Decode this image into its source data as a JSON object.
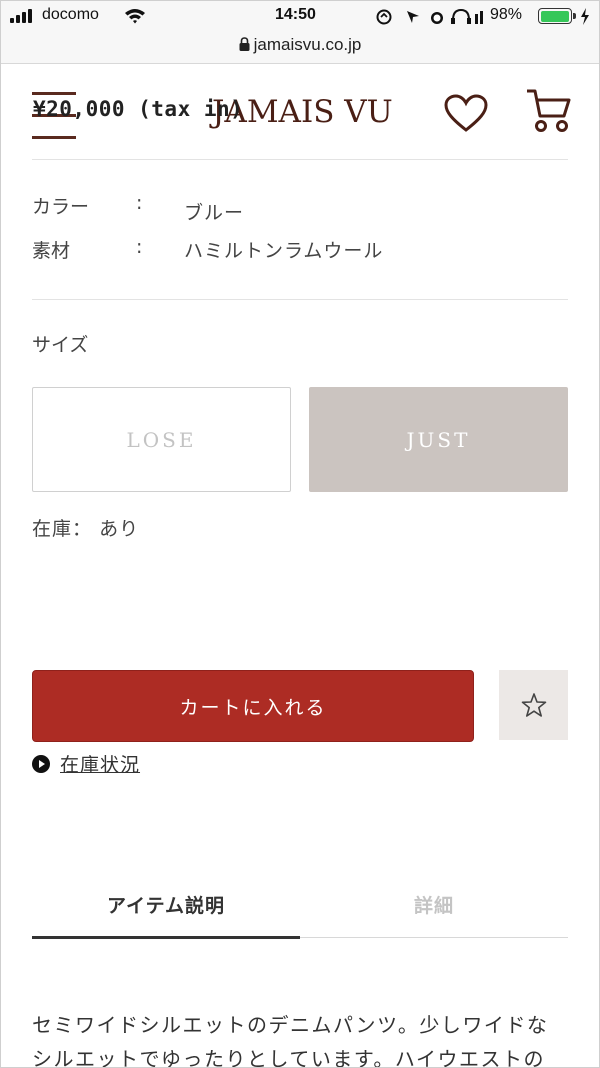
{
  "status_bar": {
    "carrier": "docomo",
    "time": "14:50",
    "battery_percent": "98%",
    "battery_level": 0.98,
    "accent_green": "#35c759"
  },
  "browser": {
    "url": "jamaisvu.co.jp",
    "lock_icon": "lock-icon"
  },
  "header": {
    "logo": "JAMAIS VU",
    "price_overlay": "¥20,000 (tax in)",
    "icons": [
      "menu-icon",
      "heart-icon",
      "cart-icon"
    ],
    "brand_color": "#4a1f15"
  },
  "specs": [
    {
      "key": "カラー",
      "sep": ":",
      "value": "ブルー"
    },
    {
      "key": "素材",
      "sep": ":",
      "value": "ハミルトンラムウール"
    }
  ],
  "size": {
    "label": "サイズ",
    "options": [
      {
        "label": "LOSE",
        "selected": false
      },
      {
        "label": "JUST",
        "selected": true
      }
    ]
  },
  "stock": {
    "label": "在庫：",
    "value": "あり"
  },
  "actions": {
    "cart_label": "カートに入れる",
    "cart_color": "#ad2c24",
    "favorite_icon": "star-icon",
    "stock_link_label": "在庫状況"
  },
  "tabs": {
    "items": [
      "アイテム説明",
      "詳細"
    ],
    "active_index": 0
  },
  "description": {
    "line1": "セミワイドシルエットのデニムパンツ。少しワイドな",
    "line2": "シルエットでゆったりとしています。ハイウエストの"
  }
}
